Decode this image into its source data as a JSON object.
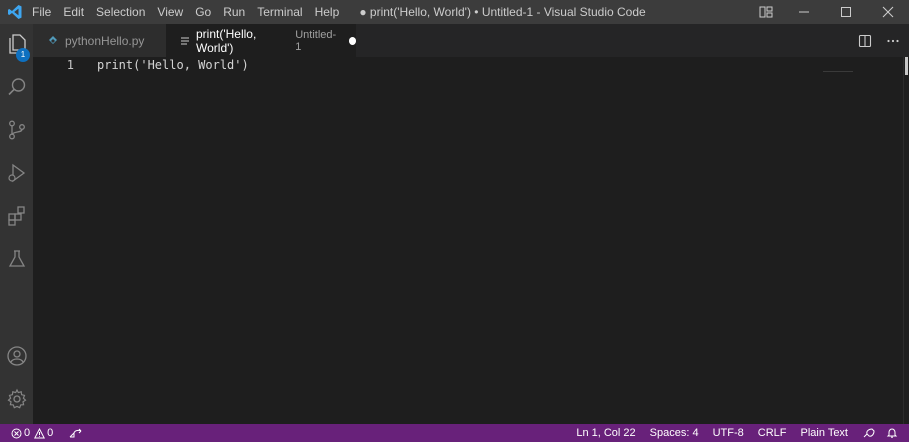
{
  "titlebar": {
    "logo_icon": "vscode-logo-icon",
    "menu": [
      "File",
      "Edit",
      "Selection",
      "View",
      "Go",
      "Run",
      "Terminal",
      "Help"
    ],
    "window_title": "● print('Hello, World') • Untitled-1 - Visual Studio Code",
    "controls": [
      "layout-icon",
      "minimize-icon",
      "maximize-icon",
      "close-icon"
    ]
  },
  "activitybar": {
    "items": [
      {
        "name": "explorer",
        "icon": "files-icon",
        "badge": "1"
      },
      {
        "name": "search",
        "icon": "search-icon"
      },
      {
        "name": "source-control",
        "icon": "source-control-icon"
      },
      {
        "name": "run-debug",
        "icon": "run-debug-icon"
      },
      {
        "name": "extensions",
        "icon": "extensions-icon"
      },
      {
        "name": "testing",
        "icon": "flask-icon"
      },
      {
        "name": "accounts",
        "icon": "account-icon"
      },
      {
        "name": "manage",
        "icon": "gear-icon"
      }
    ]
  },
  "tabs": [
    {
      "label": "pythonHello.py",
      "icon": "python-file-icon",
      "active": false
    },
    {
      "label": "print('Hello, World')",
      "description": "Untitled-1",
      "icon": "text-file-icon",
      "active": true,
      "dirty": true
    }
  ],
  "tab_actions": [
    "split-editor-icon",
    "more-actions-icon"
  ],
  "editor": {
    "lines": [
      {
        "number": "1",
        "text": "print('Hello, World')"
      }
    ]
  },
  "statusbar": {
    "errors": "0",
    "warnings": "0",
    "live_share_icon": "live-share-icon",
    "position": "Ln 1, Col 22",
    "indentation": "Spaces: 4",
    "encoding": "UTF-8",
    "eol": "CRLF",
    "language": "Plain Text",
    "feedback_icon": "feedback-icon",
    "notifications_icon": "bell-icon"
  },
  "colors": {
    "statusbar": "#68217a",
    "titlebar": "#3c3c3c",
    "activitybar": "#333333",
    "editor_bg": "#1e1e1e",
    "badge": "#0e70c0",
    "logo": "#3ea6f0"
  }
}
